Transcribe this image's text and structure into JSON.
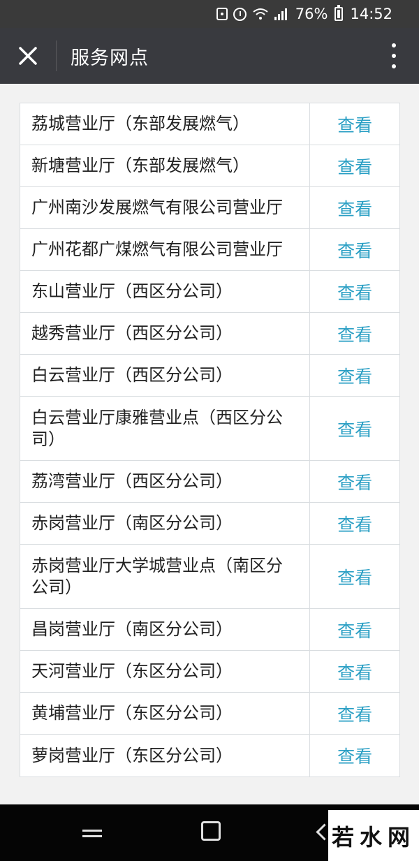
{
  "status_bar": {
    "battery": "76%",
    "time": "14:52",
    "icons": [
      "recycle-icon",
      "alarm-icon",
      "wifi-icon",
      "signal-icon",
      "battery-icon"
    ]
  },
  "header": {
    "title": "服务网点",
    "close_icon": "close-icon",
    "more_icon": "more-vertical-icon"
  },
  "list": {
    "action_color": "#2a9fc4",
    "rows": [
      {
        "name": "荔城营业厅（东部发展燃气）",
        "action": "查看"
      },
      {
        "name": "新塘营业厅（东部发展燃气）",
        "action": "查看"
      },
      {
        "name": "广州南沙发展燃气有限公司营业厅",
        "action": "查看"
      },
      {
        "name": "广州花都广煤燃气有限公司营业厅",
        "action": "查看"
      },
      {
        "name": "东山营业厅（西区分公司）",
        "action": "查看"
      },
      {
        "name": "越秀营业厅（西区分公司）",
        "action": "查看"
      },
      {
        "name": "白云营业厅（西区分公司）",
        "action": "查看"
      },
      {
        "name": "白云营业厅康雅营业点（西区分公司）",
        "action": "查看"
      },
      {
        "name": "荔湾营业厅（西区分公司）",
        "action": "查看"
      },
      {
        "name": "赤岗营业厅（南区分公司）",
        "action": "查看"
      },
      {
        "name": "赤岗营业厅大学城营业点（南区分公司）",
        "action": "查看"
      },
      {
        "name": "昌岗营业厅（南区分公司）",
        "action": "查看"
      },
      {
        "name": "天河营业厅（东区分公司）",
        "action": "查看"
      },
      {
        "name": "黄埔营业厅（东区分公司）",
        "action": "查看"
      },
      {
        "name": "萝岗营业厅（东区分公司）",
        "action": "查看"
      }
    ]
  },
  "nav_bar": {
    "icons": [
      "recent-apps-icon",
      "home-icon",
      "back-icon"
    ]
  },
  "watermark": {
    "text": "若水网"
  }
}
